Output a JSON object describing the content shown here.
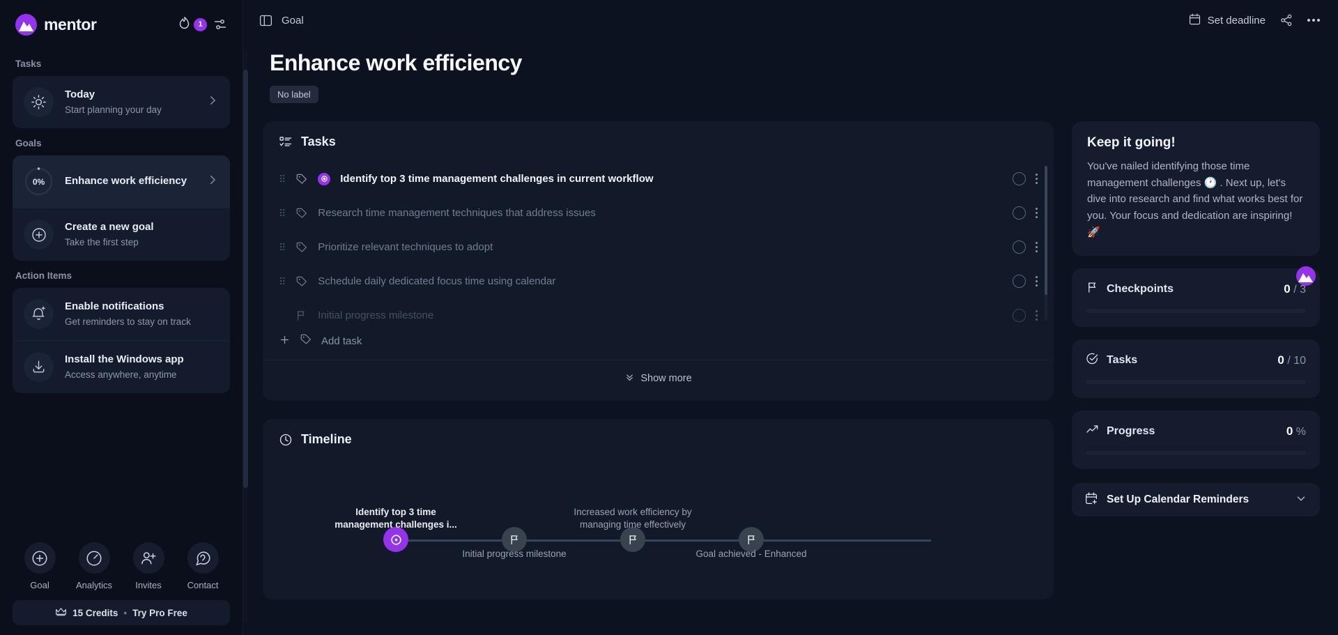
{
  "sidebar": {
    "brand": "mentor",
    "streak_count": "1",
    "sections": [
      {
        "label": "Tasks"
      },
      {
        "label": "Goals"
      },
      {
        "label": "Action Items"
      }
    ],
    "today": {
      "title": "Today",
      "subtitle": "Start planning your day"
    },
    "goals": [
      {
        "progress": "0%",
        "title": "Enhance work efficiency",
        "active": true
      },
      {
        "title": "Create a new goal",
        "subtitle": "Take the first step"
      }
    ],
    "action_items": [
      {
        "title": "Enable notifications",
        "subtitle": "Get reminders to stay on track"
      },
      {
        "title": "Install the Windows app",
        "subtitle": "Access anywhere, anytime"
      }
    ],
    "quick_nav": [
      {
        "label": "Goal",
        "icon": "plus-circle-icon"
      },
      {
        "label": "Analytics",
        "icon": "gauge-icon"
      },
      {
        "label": "Invites",
        "icon": "user-plus-icon"
      },
      {
        "label": "Contact",
        "icon": "chat-icon"
      }
    ],
    "credits": {
      "amount": "15 Credits",
      "separator": "•",
      "cta": "Try Pro Free"
    }
  },
  "topbar": {
    "breadcrumb": "Goal",
    "set_deadline": "Set deadline"
  },
  "goal": {
    "title": "Enhance work efficiency",
    "label_chip": "No label"
  },
  "tasks_card": {
    "heading": "Tasks",
    "items": [
      {
        "text": "Identify top 3 time management challenges in current workflow",
        "active": true,
        "badge": true
      },
      {
        "text": "Research time management techniques that address issues",
        "active": false
      },
      {
        "text": "Prioritize relevant techniques to adopt",
        "active": false
      },
      {
        "text": "Schedule daily dedicated focus time using calendar",
        "active": false
      },
      {
        "text": "Initial progress milestone",
        "active": false,
        "milestone": true
      }
    ],
    "add_task": "Add task",
    "show_more": "Show more"
  },
  "timeline_card": {
    "heading": "Timeline",
    "nodes": [
      {
        "caption": "Identify top 3 time management challenges i...",
        "position": "above",
        "state": "current",
        "highlight": true
      },
      {
        "caption": "Initial progress milestone",
        "position": "below",
        "state": "pending"
      },
      {
        "caption": "Increased work efficiency by managing time effectively",
        "position": "above",
        "state": "pending"
      },
      {
        "caption": "Goal achieved - Enhanced",
        "position": "below",
        "state": "pending"
      }
    ]
  },
  "encouragement": {
    "title": "Keep it going!",
    "body": "You've nailed identifying those time management challenges 🕐 . Next up, let's dive into research and find what works best for you. Your focus and dedication are inspiring! 🚀"
  },
  "stats": [
    {
      "name": "Checkpoints",
      "icon": "flag-icon",
      "value": "0",
      "total": "/ 3",
      "percent": 0
    },
    {
      "name": "Tasks",
      "icon": "check-circle-icon",
      "value": "0",
      "total": "/ 10",
      "percent": 0
    },
    {
      "name": "Progress",
      "icon": "trending-up-icon",
      "value": "0",
      "total": "%",
      "percent": 0
    }
  ],
  "reminders": {
    "label": "Set Up Calendar Reminders"
  },
  "colors": {
    "accent": "#9333ea",
    "bg": "#0b0f1c",
    "card": "#121929",
    "panel": "#151c2d"
  }
}
